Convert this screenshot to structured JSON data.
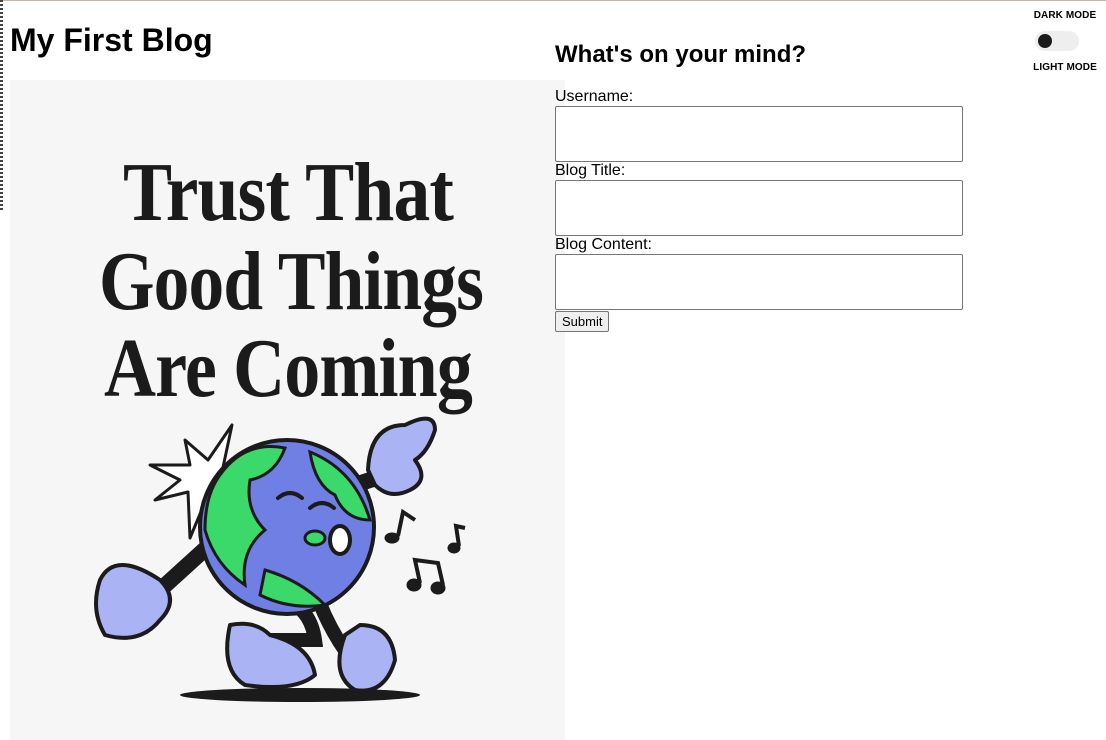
{
  "header": {
    "title": "My First Blog"
  },
  "poster": {
    "lines": [
      "Trust That",
      "Good Things",
      "Are Coming"
    ],
    "colors": {
      "ocean": "#6f7fe3",
      "land": "#3bd96a",
      "glove": "#aab4f5",
      "ink": "#1b1b1b",
      "background": "#f6f6f6"
    }
  },
  "form": {
    "heading": "What's on your mind?",
    "username_label": "Username:",
    "username_value": "",
    "title_label": "Blog Title:",
    "title_value": "",
    "content_label": "Blog Content:",
    "content_value": "",
    "submit_label": "Submit"
  },
  "theme_toggle": {
    "dark_label": "DARK MODE",
    "light_label": "LIGHT MODE",
    "state": "light"
  }
}
